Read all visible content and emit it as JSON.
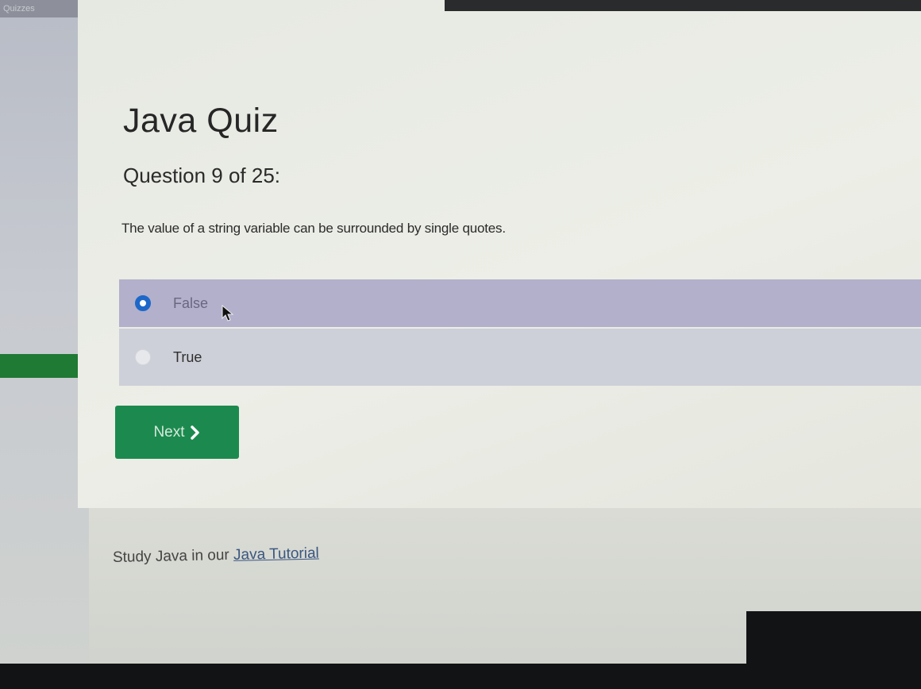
{
  "browser": {
    "tab_label": "Quizzes"
  },
  "quiz": {
    "title": "Java Quiz",
    "question_number": "Question 9 of 25:",
    "question_text": "The value of a string variable can be surrounded by single quotes.",
    "options": [
      {
        "label": "False",
        "selected": true
      },
      {
        "label": "True",
        "selected": false
      }
    ],
    "next_button_label": "Next"
  },
  "footer": {
    "prefix": "Study Java in our ",
    "link_label": "Java Tutorial"
  },
  "colors": {
    "accent_green": "#1c8a4e",
    "selected_row": "#b2b0cb",
    "radio_blue": "#1d67c9"
  },
  "icons": {
    "next": "chevron-right-icon",
    "pointer": "mouse-cursor-icon"
  }
}
